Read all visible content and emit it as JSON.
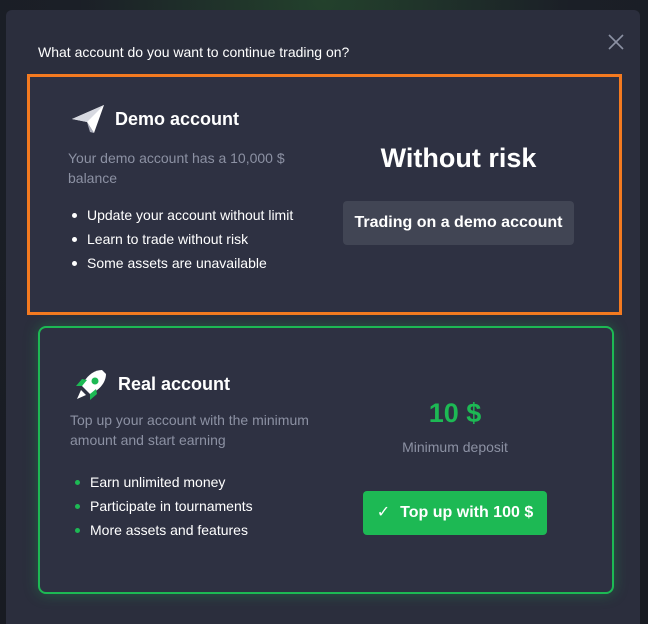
{
  "modal": {
    "title": "What account do you want to continue trading on?",
    "close_icon": "close-icon"
  },
  "demo": {
    "icon": "paper-plane-icon",
    "name": "Demo account",
    "description": "Your demo account has a 10,000 $ balance",
    "features": [
      "Update your account without limit",
      "Learn to trade without risk",
      "Some assets are unavailable"
    ],
    "headline": "Without risk",
    "button_label": "Trading on a demo account",
    "highlight_color": "#f47a20"
  },
  "real": {
    "icon": "rocket-icon",
    "name": "Real account",
    "description": "Top up your account with the minimum amount and start earning",
    "features": [
      "Earn unlimited money",
      "Participate in tournaments",
      "More assets and features"
    ],
    "amount": "10 $",
    "amount_label": "Minimum deposit",
    "button_icon": "checkmark-icon",
    "button_label": "Top up with 100 $",
    "accent_color": "#1db954"
  }
}
